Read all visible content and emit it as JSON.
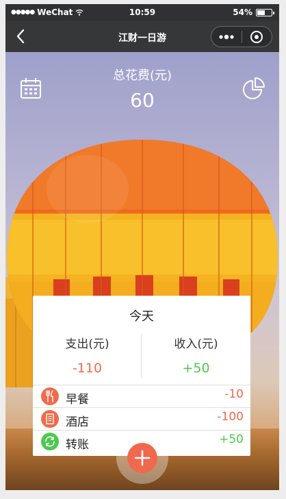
{
  "status_bar": {
    "signal": "●●●●●",
    "carrier": "WeChat",
    "time": "10:59",
    "battery_text": "54%",
    "battery_level": 0.54
  },
  "nav": {
    "title": "江财一日游",
    "back_icon": "chevron-left-icon",
    "more_icon": "more-dots-icon",
    "close_icon": "target-close-icon"
  },
  "summary": {
    "label": "总花费(元)",
    "value": "60",
    "calendar_icon": "calendar-icon",
    "chart_icon": "pie-chart-icon"
  },
  "card": {
    "day": "今天",
    "expense_label": "支出(元)",
    "expense_value": "-110",
    "income_label": "收入(元)",
    "income_value": "+50",
    "items": [
      {
        "name": "早餐",
        "amount": "-10",
        "icon": "fork-knife-icon",
        "type": "expense"
      },
      {
        "name": "酒店",
        "amount": "-100",
        "icon": "hotel-building-icon",
        "type": "expense"
      },
      {
        "name": "转账",
        "amount": "+50",
        "icon": "transfer-icon",
        "type": "income"
      }
    ]
  },
  "fab": {
    "icon": "plus-icon"
  },
  "colors": {
    "expense": "#ef6b4b",
    "income": "#4cc94c",
    "navbar": "#363739",
    "fab": "#f0684d"
  }
}
